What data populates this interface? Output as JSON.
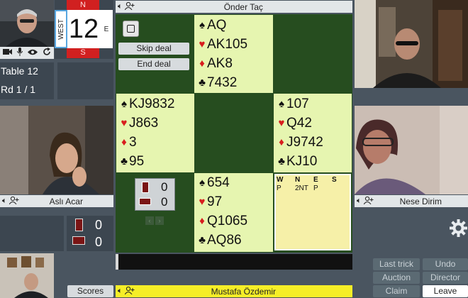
{
  "board": {
    "compass_n": "N",
    "compass_s": "S",
    "compass_e": "E",
    "compass_w": "WEST",
    "number": "12"
  },
  "table": {
    "name": "Table 12",
    "round": "Rd 1 / 1"
  },
  "controls": {
    "skip": "Skip deal",
    "end": "End deal"
  },
  "players": {
    "north": "Önder Taç",
    "west": "Aslı Acar",
    "east": "Nese Dirim",
    "south": "Mustafa Özdemir"
  },
  "hands": {
    "north": [
      {
        "suit": "spade",
        "glyph": "♠",
        "cards": "AQ"
      },
      {
        "suit": "heart",
        "glyph": "♥",
        "cards": "AK105"
      },
      {
        "suit": "diamond",
        "glyph": "♦",
        "cards": "AK8"
      },
      {
        "suit": "club",
        "glyph": "♣",
        "cards": "7432"
      }
    ],
    "west": [
      {
        "suit": "spade",
        "glyph": "♠",
        "cards": "KJ9832"
      },
      {
        "suit": "heart",
        "glyph": "♥",
        "cards": "J863"
      },
      {
        "suit": "diamond",
        "glyph": "♦",
        "cards": "3"
      },
      {
        "suit": "club",
        "glyph": "♣",
        "cards": "95"
      }
    ],
    "east": [
      {
        "suit": "spade",
        "glyph": "♠",
        "cards": "107"
      },
      {
        "suit": "heart",
        "glyph": "♥",
        "cards": "Q42"
      },
      {
        "suit": "diamond",
        "glyph": "♦",
        "cards": "J9742"
      },
      {
        "suit": "club",
        "glyph": "♣",
        "cards": "KJ10"
      }
    ],
    "south": [
      {
        "suit": "spade",
        "glyph": "♠",
        "cards": "654"
      },
      {
        "suit": "heart",
        "glyph": "♥",
        "cards": "97"
      },
      {
        "suit": "diamond",
        "glyph": "♦",
        "cards": "Q1065"
      },
      {
        "suit": "club",
        "glyph": "♣",
        "cards": "AQ86"
      }
    ]
  },
  "tricks": {
    "ns": "0",
    "ew": "0"
  },
  "score_box": {
    "ns": "0",
    "ew": "0"
  },
  "bidding": {
    "headers": [
      "W",
      "N",
      "E",
      "S"
    ],
    "bids": [
      "P",
      "2NT",
      "P",
      ""
    ]
  },
  "actions": {
    "last_trick": "Last trick",
    "undo": "Undo",
    "auction": "Auction",
    "director": "Director",
    "claim": "Claim",
    "leave": "Leave",
    "scores": "Scores"
  },
  "colors": {
    "felt": "#264d1f",
    "cell": "#e6f5b0",
    "south_bar": "#f5ee27",
    "red_suit": "#d81e1e"
  },
  "icons": [
    "speaker-icon",
    "add-user-icon",
    "camera-icon",
    "microphone-icon",
    "eye-icon",
    "refresh-icon",
    "settings-icon"
  ]
}
